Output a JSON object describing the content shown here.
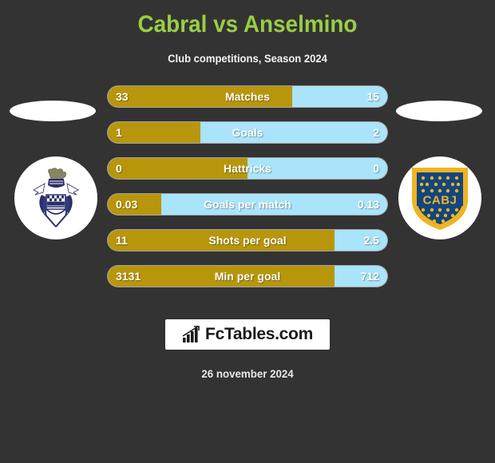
{
  "header": {
    "title": "Cabral vs Anselmino",
    "subtitle": "Club competitions, Season 2024",
    "title_color": "#9acd45"
  },
  "theme": {
    "background": "#333333",
    "home_color": "#b8960c",
    "away_color": "#a9e4fa",
    "text_color": "#ffffff"
  },
  "teams": {
    "home": {
      "crest_name": "gimnasia-la-plata-crest",
      "crest_text": ""
    },
    "away": {
      "crest_name": "boca-juniors-crest",
      "crest_text": "CABJ"
    }
  },
  "chart_data": {
    "type": "bar",
    "title": "Cabral vs Anselmino",
    "subtitle": "Club competitions, Season 2024",
    "orientation": "horizontal-diverging",
    "series": [
      {
        "name": "Cabral",
        "color": "#b8960c"
      },
      {
        "name": "Anselmino",
        "color": "#a9e4fa"
      }
    ],
    "categories": [
      "Matches",
      "Goals",
      "Hattricks",
      "Goals per match",
      "Shots per goal",
      "Min per goal"
    ],
    "rows": [
      {
        "label": "Matches",
        "home": "33",
        "away": "15",
        "home_pct": 66
      },
      {
        "label": "Goals",
        "home": "1",
        "away": "2",
        "home_pct": 33
      },
      {
        "label": "Hattricks",
        "home": "0",
        "away": "0",
        "home_pct": 50
      },
      {
        "label": "Goals per match",
        "home": "0.03",
        "away": "0.13",
        "home_pct": 19
      },
      {
        "label": "Shots per goal",
        "home": "11",
        "away": "2.5",
        "home_pct": 81
      },
      {
        "label": "Min per goal",
        "home": "3131",
        "away": "712",
        "home_pct": 81
      }
    ]
  },
  "footer": {
    "brand": "FcTables.com",
    "brand_icon": "bar-chart-icon",
    "date": "26 november 2024"
  }
}
